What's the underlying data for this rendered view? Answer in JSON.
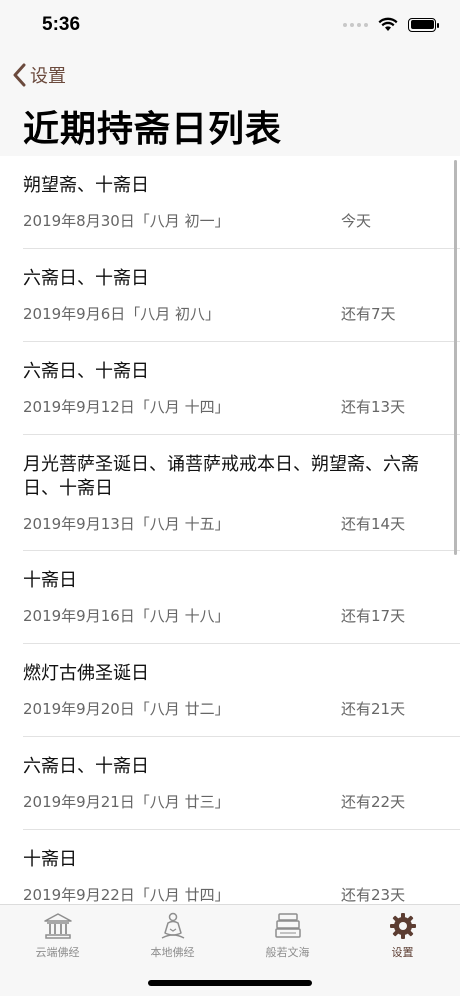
{
  "status_bar": {
    "time": "5:36"
  },
  "nav": {
    "back_label": "设置",
    "title": "近期持斋日列表"
  },
  "list": [
    {
      "title": "朔望斋、十斋日",
      "date": "2019年8月30日「八月 初一」",
      "status": "今天"
    },
    {
      "title": "六斋日、十斋日",
      "date": "2019年9月6日「八月 初八」",
      "status": "还有7天"
    },
    {
      "title": "六斋日、十斋日",
      "date": "2019年9月12日「八月 十四」",
      "status": "还有13天"
    },
    {
      "title": "月光菩萨圣诞日、诵菩萨戒戒本日、朔望斋、六斋日、十斋日",
      "date": "2019年9月13日「八月 十五」",
      "status": "还有14天"
    },
    {
      "title": "十斋日",
      "date": "2019年9月16日「八月 十八」",
      "status": "还有17天"
    },
    {
      "title": "燃灯古佛圣诞日",
      "date": "2019年9月20日「八月 廿二」",
      "status": "还有21天"
    },
    {
      "title": "六斋日、十斋日",
      "date": "2019年9月21日「八月 廿三」",
      "status": "还有22天"
    },
    {
      "title": "十斋日",
      "date": "2019年9月22日「八月 廿四」",
      "status": "还有23天"
    }
  ],
  "tabs": [
    {
      "label": "云端佛经",
      "icon": "temple-icon"
    },
    {
      "label": "本地佛经",
      "icon": "buddha-icon"
    },
    {
      "label": "般若文海",
      "icon": "books-icon"
    },
    {
      "label": "设置",
      "icon": "gear-icon",
      "active": true
    }
  ],
  "colors": {
    "accent": "#5c3d32",
    "inactive": "#8e8e8e"
  }
}
